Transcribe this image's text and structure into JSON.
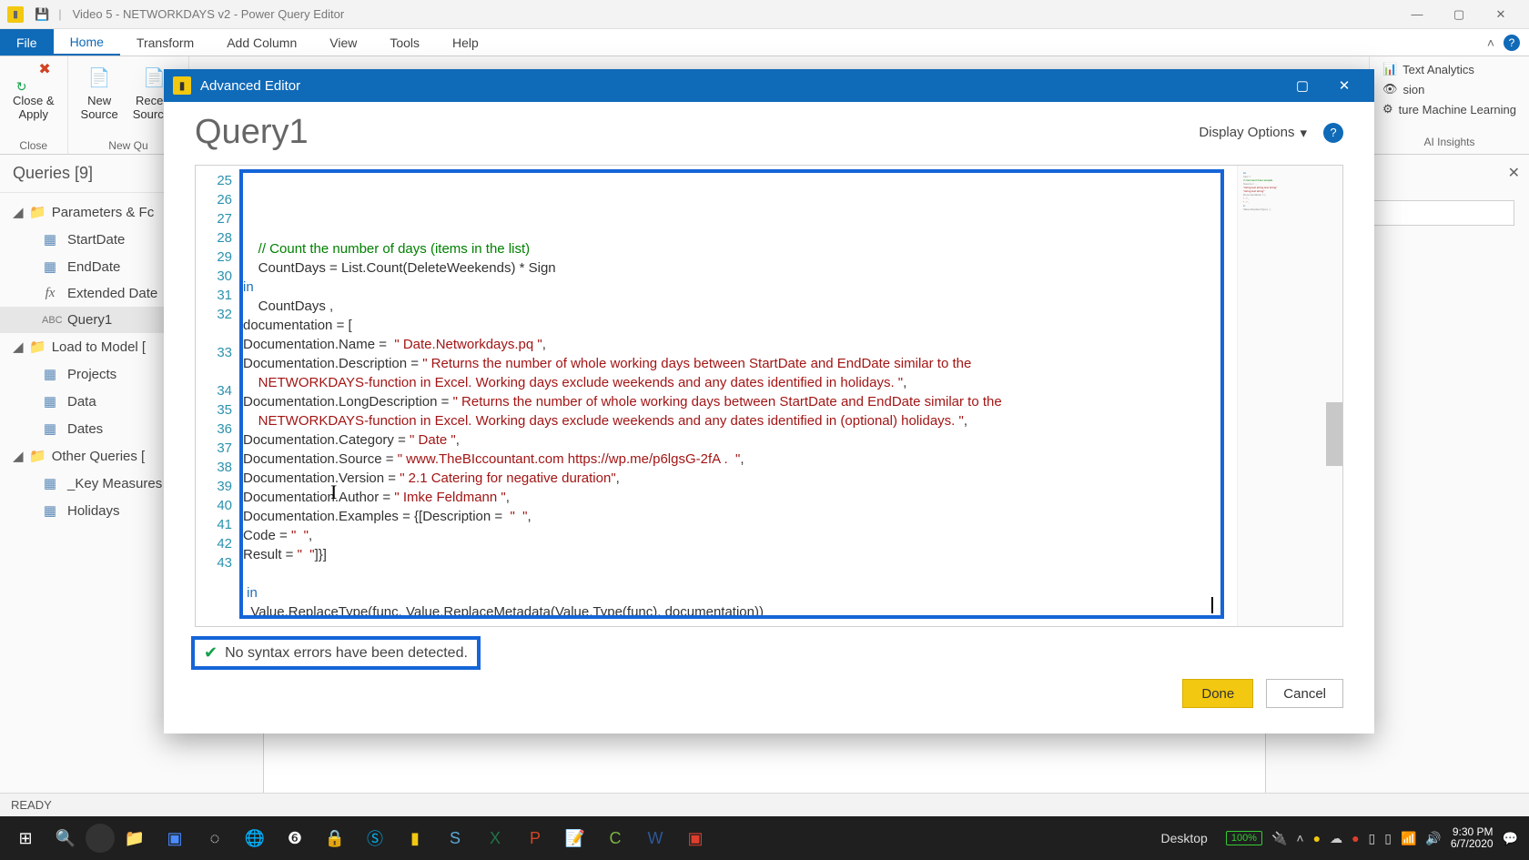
{
  "titlebar": {
    "app_title": "Video 5 - NETWORKDAYS v2 - Power Query Editor"
  },
  "ribbon": {
    "file": "File",
    "tabs": [
      "Home",
      "Transform",
      "Add Column",
      "View",
      "Tools",
      "Help"
    ],
    "active_tab": "Home",
    "close_apply": "Close &\nApply",
    "new_source": "New\nSource",
    "recent_sources": "Recent\nSources",
    "group_close": "Close",
    "group_newq": "New Qu",
    "ai": {
      "text_analytics": "Text Analytics",
      "vision": "sion",
      "ml": "ture Machine Learning",
      "group": "AI Insights"
    }
  },
  "queries": {
    "header": "Queries [9]",
    "groups": [
      {
        "name": "Parameters & Fc",
        "items": [
          {
            "icon": "table",
            "label": "StartDate"
          },
          {
            "icon": "table",
            "label": "EndDate"
          },
          {
            "icon": "fx",
            "label": "Extended Date"
          },
          {
            "icon": "abc",
            "label": "Query1",
            "selected": true
          }
        ]
      },
      {
        "name": "Load to Model [",
        "items": [
          {
            "icon": "table",
            "label": "Projects"
          },
          {
            "icon": "table",
            "label": "Data"
          },
          {
            "icon": "table",
            "label": "Dates"
          }
        ]
      },
      {
        "name": "Other Queries [",
        "items": [
          {
            "icon": "table",
            "label": "_Key Measures"
          },
          {
            "icon": "table",
            "label": "Holidays"
          }
        ]
      }
    ]
  },
  "statusbar": {
    "text": "READY"
  },
  "taskbar": {
    "desktop_label": "Desktop",
    "battery": "100%",
    "time": "9:30 PM",
    "date": "6/7/2020"
  },
  "modal": {
    "title": "Advanced Editor",
    "query_name": "Query1",
    "display_options": "Display Options",
    "syntax_msg": "No syntax errors have been detected.",
    "done": "Done",
    "cancel": "Cancel",
    "line_start": 25,
    "lines": [
      {
        "n": 25,
        "segs": [
          {
            "t": "",
            "c": ""
          }
        ]
      },
      {
        "n": 26,
        "segs": [
          {
            "t": "    ",
            "c": ""
          },
          {
            "t": "// Count the number of days (items in the list)",
            "c": "cm-comment"
          }
        ]
      },
      {
        "n": 27,
        "segs": [
          {
            "t": "    CountDays = List.Count(DeleteWeekends) * Sign",
            "c": "cm-id"
          }
        ]
      },
      {
        "n": 28,
        "segs": [
          {
            "t": "in",
            "c": "cm-kw"
          }
        ]
      },
      {
        "n": 29,
        "segs": [
          {
            "t": "    CountDays ,",
            "c": "cm-id"
          }
        ]
      },
      {
        "n": 30,
        "segs": [
          {
            "t": "documentation = [",
            "c": "cm-id"
          }
        ]
      },
      {
        "n": 31,
        "segs": [
          {
            "t": "Documentation.Name =  ",
            "c": "cm-id"
          },
          {
            "t": "\" Date.Networkdays.pq \"",
            "c": "cm-str"
          },
          {
            "t": ",",
            "c": "cm-id"
          }
        ]
      },
      {
        "n": 32,
        "segs": [
          {
            "t": "Documentation.Description = ",
            "c": "cm-id"
          },
          {
            "t": "\" Returns the number of whole working days between StartDate and EndDate similar to the",
            "c": "cm-str"
          }
        ]
      },
      {
        "n": 0,
        "segs": [
          {
            "t": "    NETWORKDAYS-function in Excel. Working days exclude weekends and any dates identified in holidays. \"",
            "c": "cm-str"
          },
          {
            "t": ",",
            "c": "cm-id"
          }
        ]
      },
      {
        "n": 33,
        "segs": [
          {
            "t": "Documentation.LongDescription = ",
            "c": "cm-id"
          },
          {
            "t": "\" Returns the number of whole working days between StartDate and EndDate similar to the",
            "c": "cm-str"
          }
        ]
      },
      {
        "n": 0,
        "segs": [
          {
            "t": "    NETWORKDAYS-function in Excel. Working days exclude weekends and any dates identified in (optional) holidays. \"",
            "c": "cm-str"
          },
          {
            "t": ",",
            "c": "cm-id"
          }
        ]
      },
      {
        "n": 34,
        "segs": [
          {
            "t": "Documentation.Category = ",
            "c": "cm-id"
          },
          {
            "t": "\" Date \"",
            "c": "cm-str"
          },
          {
            "t": ",",
            "c": "cm-id"
          }
        ]
      },
      {
        "n": 35,
        "segs": [
          {
            "t": "Documentation.Source = ",
            "c": "cm-id"
          },
          {
            "t": "\" www.TheBIccountant.com https://wp.me/p6lgsG-2fA .  \"",
            "c": "cm-str"
          },
          {
            "t": ",",
            "c": "cm-id"
          }
        ]
      },
      {
        "n": 36,
        "segs": [
          {
            "t": "Documentation.Version = ",
            "c": "cm-id"
          },
          {
            "t": "\" 2.1 Catering for negative duration\"",
            "c": "cm-str"
          },
          {
            "t": ",",
            "c": "cm-id"
          }
        ]
      },
      {
        "n": 37,
        "segs": [
          {
            "t": "Documentation.Author = ",
            "c": "cm-id"
          },
          {
            "t": "\" Imke Feldmann \"",
            "c": "cm-str"
          },
          {
            "t": ",",
            "c": "cm-id"
          }
        ]
      },
      {
        "n": 38,
        "segs": [
          {
            "t": "Documentation.Examples = {[Description = ",
            "c": "cm-id"
          },
          {
            "t": " \"  \"",
            "c": "cm-str"
          },
          {
            "t": ",",
            "c": "cm-id"
          }
        ]
      },
      {
        "n": 39,
        "segs": [
          {
            "t": "Code = ",
            "c": "cm-id"
          },
          {
            "t": "\"  \"",
            "c": "cm-str"
          },
          {
            "t": ",",
            "c": "cm-id"
          }
        ]
      },
      {
        "n": 40,
        "segs": [
          {
            "t": "Result = ",
            "c": "cm-id"
          },
          {
            "t": "\"  \"",
            "c": "cm-str"
          },
          {
            "t": "]}]",
            "c": "cm-id"
          }
        ]
      },
      {
        "n": 41,
        "segs": [
          {
            "t": "",
            "c": ""
          }
        ]
      },
      {
        "n": 42,
        "segs": [
          {
            "t": " ",
            "c": ""
          },
          {
            "t": "in",
            "c": "cm-kw"
          }
        ]
      },
      {
        "n": 43,
        "segs": [
          {
            "t": "  Value.ReplaceType(func, Value.ReplaceMetadata(Value.Type(func), documentation))",
            "c": "cm-id"
          }
        ]
      }
    ]
  }
}
